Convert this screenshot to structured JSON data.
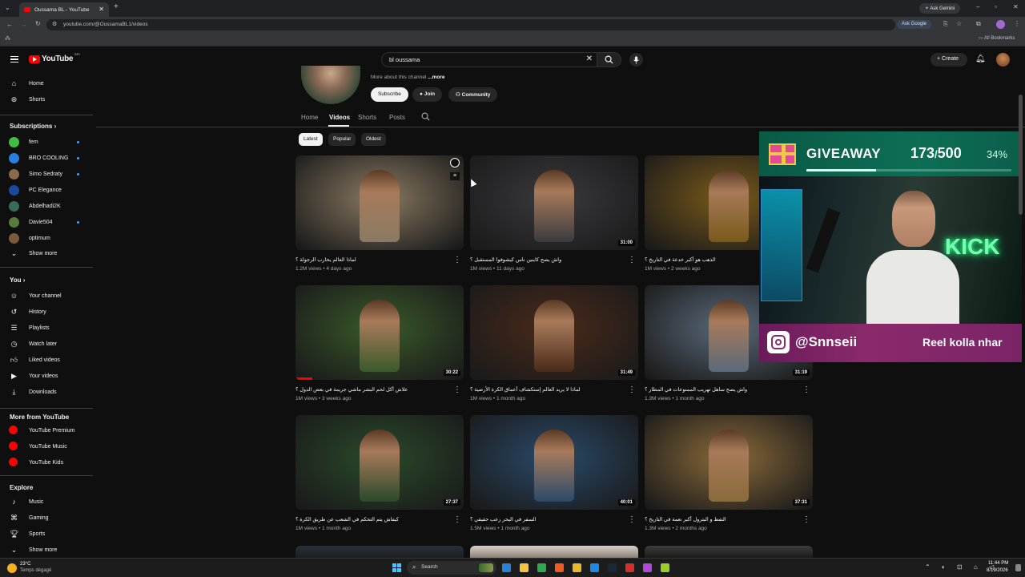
{
  "browser": {
    "tab_title": "Oussama BL - YouTube",
    "new_tab": "+",
    "url": "youtube.com/@OussamaBL1/videos",
    "ask_gemini": "Ask Gemini",
    "ask_google": "Ask Google",
    "all_bookmarks": "All Bookmarks"
  },
  "youtube": {
    "logo_text": "YouTube",
    "logo_badge": "MA",
    "search_value": "bl oussama",
    "create_label": "Create"
  },
  "sidebar": {
    "main": [
      {
        "label": "Home",
        "icon": "home-icon"
      },
      {
        "label": "Shorts",
        "icon": "shorts-icon"
      }
    ],
    "subscriptions_header": "Subscriptions",
    "subscriptions": [
      {
        "label": "fem",
        "color": "#3fbf3f",
        "dot": true
      },
      {
        "label": "BRO COOLING",
        "color": "#2a7de1",
        "dot": true
      },
      {
        "label": "Simo Sedraty",
        "color": "#8a6a4a",
        "dot": true
      },
      {
        "label": "PC Elegance",
        "color": "#1a4aa0",
        "dot": false
      },
      {
        "label": "Abdelhadi2K",
        "color": "#3a6a5a",
        "dot": false
      },
      {
        "label": "Davie504",
        "color": "#5a7a3a",
        "dot": true
      },
      {
        "label": "optimum",
        "color": "#7a5a3a",
        "dot": false
      }
    ],
    "show_more": "Show more",
    "you_header": "You",
    "you_items": [
      {
        "label": "Your channel",
        "icon": "channel-icon"
      },
      {
        "label": "History",
        "icon": "history-icon"
      },
      {
        "label": "Playlists",
        "icon": "playlists-icon"
      },
      {
        "label": "Watch later",
        "icon": "watch-later-icon"
      },
      {
        "label": "Liked videos",
        "icon": "like-icon"
      },
      {
        "label": "Your videos",
        "icon": "your-videos-icon"
      },
      {
        "label": "Downloads",
        "icon": "download-icon"
      }
    ],
    "more_header": "More from YouTube",
    "more_items": [
      {
        "label": "YouTube Premium"
      },
      {
        "label": "YouTube Music"
      },
      {
        "label": "YouTube Kids"
      }
    ],
    "explore_header": "Explore",
    "explore_items": [
      {
        "label": "Music",
        "icon": "music-icon"
      },
      {
        "label": "Gaming",
        "icon": "gaming-icon"
      },
      {
        "label": "Sports",
        "icon": "sports-icon"
      },
      {
        "label": "Show more",
        "icon": "chevron-down-icon"
      }
    ]
  },
  "channel": {
    "more_about": "More about this channel",
    "more_link": "...more",
    "subscribe": "Subscribe",
    "join": "Join",
    "community": "Community",
    "tabs": [
      "Home",
      "Videos",
      "Shorts",
      "Posts"
    ],
    "active_tab": "Videos",
    "filters": [
      "Latest",
      "Popular",
      "Oldest"
    ],
    "active_filter": "Latest"
  },
  "videos": [
    {
      "title": "لماذا العالم يحارب الرجولة ؟",
      "meta": "1.2M views • 4 days ago",
      "duration": "",
      "bg": "#8a7a62"
    },
    {
      "title": "واش يصح كاينين ناس كيشوفوا المستقبل ؟",
      "meta": "1M views • 11 days ago",
      "duration": "31:00",
      "bg": "#3a3a3e"
    },
    {
      "title": "الذهب هو أكبر خدعة في التاريخ ؟",
      "meta": "1M views • 2 weeks ago",
      "duration": "",
      "bg": "#7a5a1a"
    },
    {
      "title": "علاش أكل لحم البشر ماشي جريمة في بعض الدول ؟",
      "meta": "1M views • 3 weeks ago",
      "duration": "30:22",
      "bg": "#3a5a2a",
      "progress": 0.1
    },
    {
      "title": "لماذا لا يريد العالم إستكشاف أعماق الكرة الأرضية ؟",
      "meta": "1M views • 1 month ago",
      "duration": "31:49",
      "bg": "#4a2a1a"
    },
    {
      "title": "واش يصح ساهل تهريب الممنوعات في المطار ؟",
      "meta": "1.3M views • 1 month ago",
      "duration": "31:19",
      "bg": "#5a6a7a"
    },
    {
      "title": "كيفاش يتم التحكم في الشعب عن طريق الكرة ؟",
      "meta": "1M views • 1 month ago",
      "duration": "27:37",
      "bg": "#2a4a2a"
    },
    {
      "title": "السفر في البحر رعب حقيقي ؟",
      "meta": "1.5M views • 1 month ago",
      "duration": "40:01",
      "bg": "#2a4a6a"
    },
    {
      "title": "النفط و البترول أكبر نعمة في التاريخ ؟",
      "meta": "1.3M views • 2 months ago",
      "duration": "37:31",
      "bg": "#8a6a3a"
    }
  ],
  "overlay": {
    "giveaway_label": "GIVEAWAY",
    "count_current": "173",
    "count_sep": "/",
    "count_total": "500",
    "percent": "34%",
    "progress_fraction": 0.34,
    "instagram_handle": "@Snnseii",
    "reel_text": "Reel kolla nhar",
    "neon_text": "KICK"
  },
  "taskbar": {
    "weather_temp": "23°C",
    "weather_desc": "Temps dégagé",
    "search_label": "Search",
    "time": "11:44 PM",
    "date": "8/19/2026"
  }
}
